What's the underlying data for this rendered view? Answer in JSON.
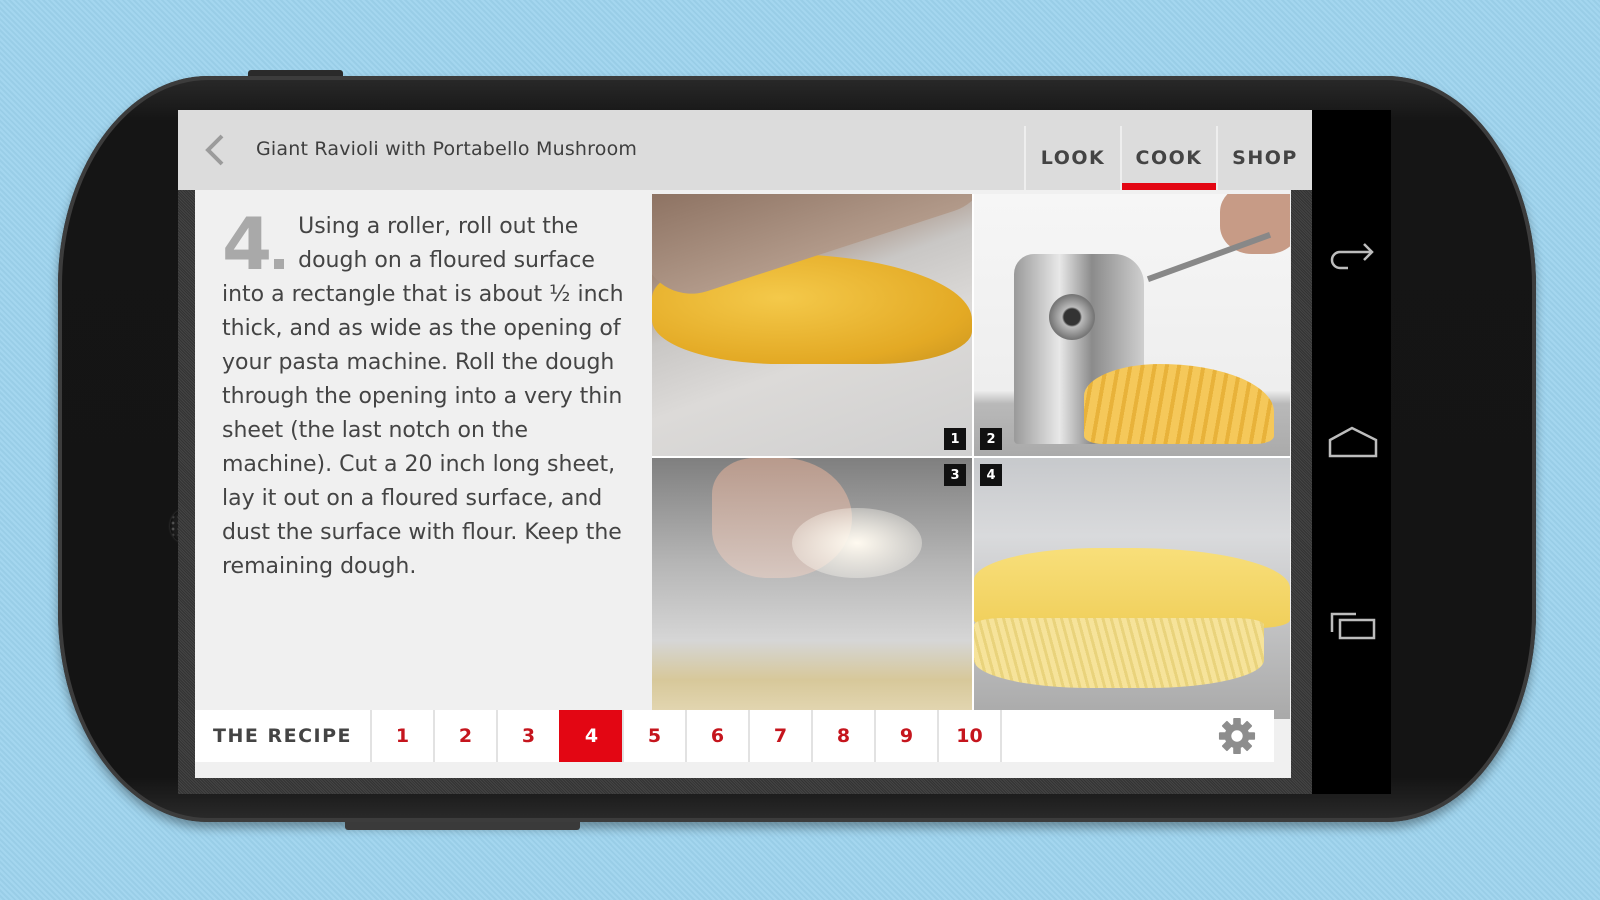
{
  "header": {
    "title": "Giant Ravioli with Portabello Mushroom",
    "back_icon": "chevron-left-icon",
    "tabs": [
      {
        "label": "LOOK",
        "active": false
      },
      {
        "label": "COOK",
        "active": true
      },
      {
        "label": "SHOP",
        "active": false
      }
    ]
  },
  "step": {
    "number": "4",
    "text": "Using a roller, roll out the dough on a floured surface into a rectangle that is about ½ inch thick, and as wide as the opening of your pasta machine. Roll the dough through the opening into a very thin sheet (the last notch on the machine). Cut a 20 inch long sheet, lay it out on a floured surface, and dust the surface with flour. Keep the remaining dough."
  },
  "photos": [
    {
      "badge": "1",
      "subject": "rolling dough with rolling pin"
    },
    {
      "badge": "2",
      "subject": "pasta machine rolling sheet"
    },
    {
      "badge": "3",
      "subject": "hand dusting flour"
    },
    {
      "badge": "4",
      "subject": "folded pasta sheets"
    }
  ],
  "bottom_bar": {
    "recipe_label": "THE RECIPE",
    "steps": [
      "1",
      "2",
      "3",
      "4",
      "5",
      "6",
      "7",
      "8",
      "9",
      "10"
    ],
    "active_step": "4",
    "settings_icon": "gear-icon"
  },
  "system_nav": {
    "buttons": [
      "back-icon",
      "home-icon",
      "recent-apps-icon"
    ]
  },
  "colors": {
    "accent": "#e30613",
    "step_number_text": "#c5151d",
    "header_bg": "#dcdcdc",
    "body_bg": "#f0f0f0",
    "background": "#9ed4ee"
  }
}
